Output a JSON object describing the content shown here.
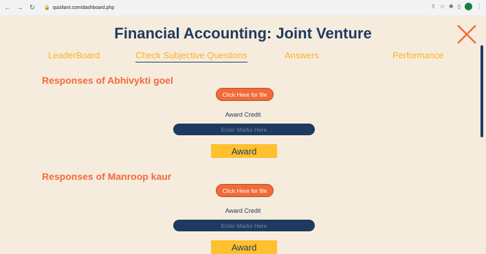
{
  "browser": {
    "url": "quizliant.com/dashboard.php",
    "profile_initial": ""
  },
  "page": {
    "title": "Financial Accounting: Joint Venture",
    "nav": [
      {
        "label": "LeaderBoard",
        "active": false
      },
      {
        "label": "Check Subjective Questions",
        "active": true
      },
      {
        "label": "Answers",
        "active": false
      },
      {
        "label": "Performance",
        "active": false
      }
    ]
  },
  "responses": [
    {
      "name": "Responses of Abhivykti goel",
      "file_button": "Click Here for file",
      "award_credit_label": "Award Credit",
      "marks_placeholder": "Enter Marks Here",
      "award_button": "Award"
    },
    {
      "name": "Responses of Manroop kaur",
      "file_button": "Click Here for file",
      "award_credit_label": "Award Credit",
      "marks_placeholder": "Enter Marks Here",
      "award_button": "Award"
    }
  ],
  "colors": {
    "navy": "#1e3a5f",
    "orange": "#f36a3a",
    "yellow": "#ffc02e",
    "background": "#f5ecde"
  }
}
